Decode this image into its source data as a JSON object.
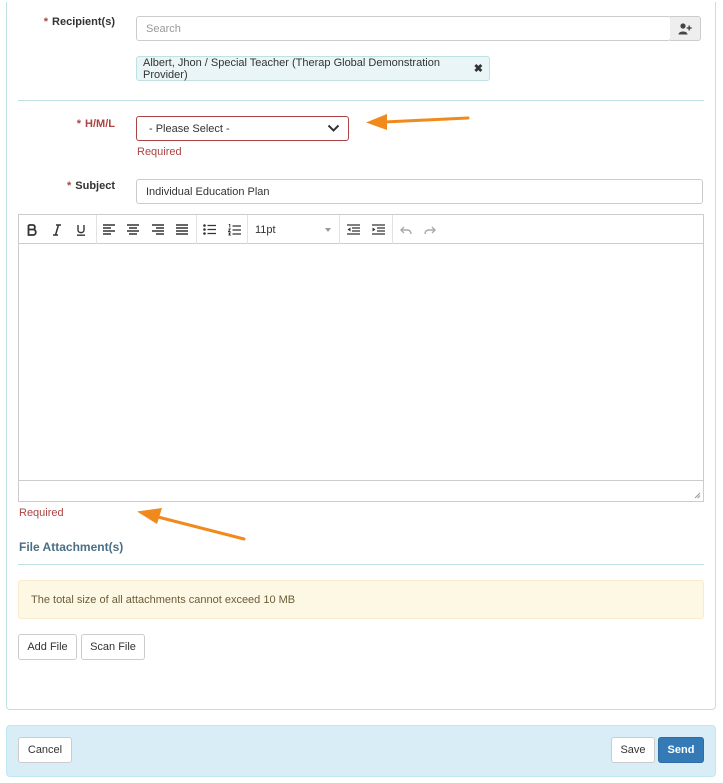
{
  "recipients": {
    "label": "Recipient(s)",
    "required_mark": "*",
    "search_placeholder": "Search",
    "selected": [
      {
        "text": "Albert, Jhon / Special Teacher (Therap Global Demonstration Provider)",
        "remove_symbol": "✖"
      }
    ],
    "add_icon": "user-plus-icon"
  },
  "hml": {
    "label": "H/M/L",
    "required_mark": "*",
    "selected_value": "- Please Select -",
    "error": "Required"
  },
  "subject": {
    "label": "Subject",
    "required_mark": "*",
    "value": "Individual Education Plan"
  },
  "editor": {
    "font_size": "11pt",
    "tools": [
      "bold",
      "italic",
      "underline",
      "align-left",
      "align-center",
      "align-right",
      "align-justify",
      "bullet-list",
      "numbered-list",
      "font-size",
      "outdent",
      "indent",
      "undo",
      "redo"
    ],
    "error": "Required"
  },
  "attachments": {
    "title": "File Attachment(s)",
    "notice": "The total size of all attachments cannot exceed 10 MB",
    "add_file_label": "Add File",
    "scan_file_label": "Scan File"
  },
  "footer": {
    "cancel_label": "Cancel",
    "save_label": "Save",
    "send_label": "Send"
  },
  "colors": {
    "error": "#a94442",
    "primary": "#337ab7",
    "annotation_arrow": "#f08a1c",
    "footer_bg": "#d9edf7"
  }
}
